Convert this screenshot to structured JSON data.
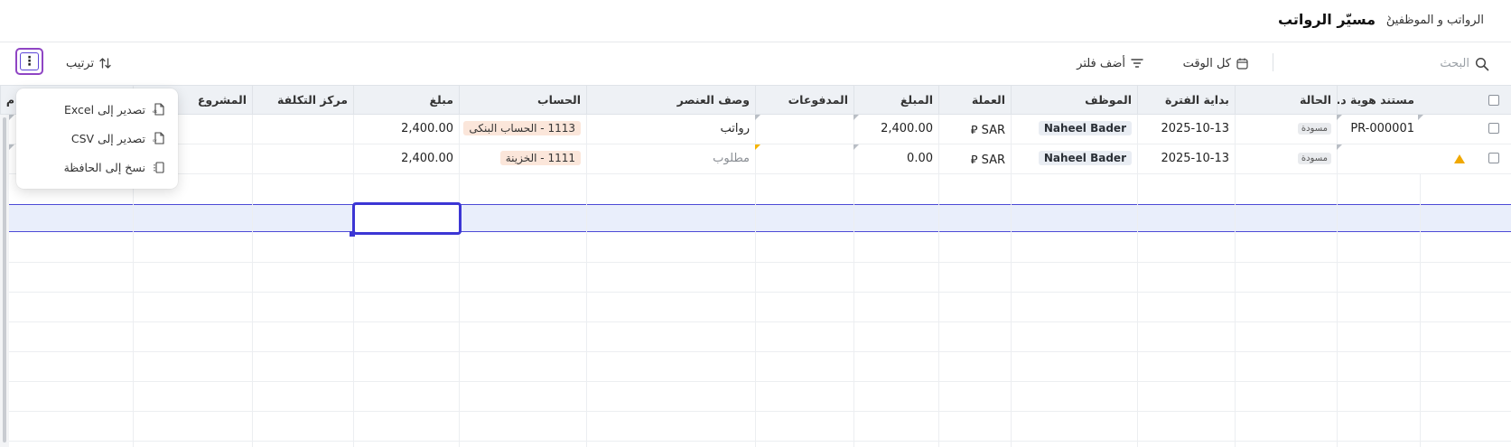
{
  "breadcrumb": {
    "parent": "الرواتب و الموظفين",
    "separator": "›",
    "title": "مسيّر الرواتب"
  },
  "toolbar": {
    "search_placeholder": "البحث",
    "time_label": "كل الوقت",
    "filter_label": "أضف فلتر",
    "sort_label": "ترتيب",
    "more_label": "⋮"
  },
  "menu": {
    "items": [
      {
        "label": "تصدير إلى Excel",
        "icon": "excel-file-icon"
      },
      {
        "label": "تصدير إلى CSV",
        "icon": "csv-file-icon"
      },
      {
        "label": "نسخ إلى الحافظة",
        "icon": "clipboard-icon"
      }
    ]
  },
  "table": {
    "columns": {
      "doc_id": "مستند هوية د...",
      "status": "الحالة",
      "period_start": "بداية الفترة",
      "employee": "الموظف",
      "currency": "العملة",
      "amount": "المبلغ",
      "payments": "المدفوعات",
      "item_desc": "وصف العنصر",
      "account": "الحساب",
      "line_amount": "مبلغ",
      "cost_center": "مركز التكلفة",
      "project": "المشروع",
      "extra": "م"
    },
    "rows": [
      {
        "doc_id": "PR-000001",
        "status": "مسودة",
        "period_start": "2025-10-13",
        "employee": "Naheel Bader",
        "currency": "SAR",
        "currency_symbol": "⃁",
        "amount": "2,400.00",
        "payments": "",
        "item_desc": "رواتب",
        "account": "1113 - الحساب البنكى",
        "line_amount": "2,400.00",
        "cost_center": "",
        "project": ""
      },
      {
        "doc_id": "",
        "status": "مسودة",
        "period_start": "2025-10-13",
        "employee": "Naheel Bader",
        "currency": "SAR",
        "currency_symbol": "⃁",
        "amount": "0.00",
        "payments": "",
        "item_desc": "مطلوب",
        "account": "1111 - الخزينة",
        "line_amount": "2,400.00",
        "cost_center": "",
        "project": ""
      }
    ]
  }
}
